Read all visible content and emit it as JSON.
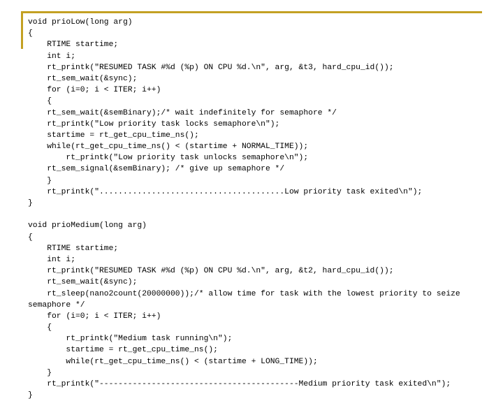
{
  "slide": {
    "background_color": "#ffffff",
    "accent_color": "#C3A023",
    "text_color": "#000000"
  },
  "code": {
    "language": "c",
    "lines": [
      "void prioLow(long arg)",
      "{",
      "    RTIME startime;",
      "    int i;",
      "    rt_printk(\"RESUMED TASK #%d (%p) ON CPU %d.\\n\", arg, &t3, hard_cpu_id());",
      "    rt_sem_wait(&sync);",
      "    for (i=0; i < ITER; i++)",
      "    {",
      "    rt_sem_wait(&semBinary);/* wait indefinitely for semaphore */",
      "    rt_printk(\"Low priority task locks semaphore\\n\");",
      "    startime = rt_get_cpu_time_ns();",
      "    while(rt_get_cpu_time_ns() < (startime + NORMAL_TIME));",
      "        rt_printk(\"Low priority task unlocks semaphore\\n\");",
      "    rt_sem_signal(&semBinary); /* give up semaphore */",
      "    }",
      "    rt_printk(\".......................................Low priority task exited\\n\");",
      "}",
      "",
      "void prioMedium(long arg)",
      "{",
      "    RTIME startime;",
      "    int i;",
      "    rt_printk(\"RESUMED TASK #%d (%p) ON CPU %d.\\n\", arg, &t2, hard_cpu_id());",
      "    rt_sem_wait(&sync);",
      "    rt_sleep(nano2count(20000000));/* allow time for task with the lowest priority to seize semaphore */",
      "    for (i=0; i < ITER; i++)",
      "    {",
      "        rt_printk(\"Medium task running\\n\");",
      "        startime = rt_get_cpu_time_ns();",
      "        while(rt_get_cpu_time_ns() < (startime + LONG_TIME));",
      "    }",
      "    rt_printk(\"------------------------------------------Medium priority task exited\\n\");",
      "}"
    ],
    "wrapped_line_indexes": [
      24
    ]
  }
}
